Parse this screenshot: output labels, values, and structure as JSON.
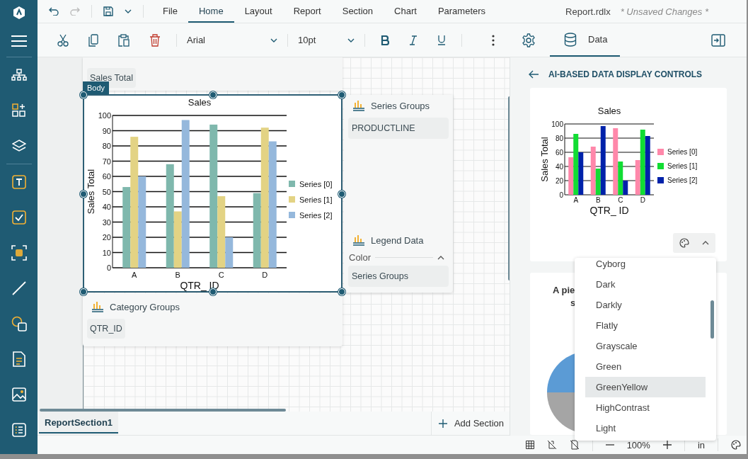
{
  "app": {
    "file_name": "Report.rdlx",
    "status": "* Unsaved Changes *"
  },
  "menu_tabs": [
    {
      "label": "File",
      "selected": false
    },
    {
      "label": "Home",
      "selected": true
    },
    {
      "label": "Layout",
      "selected": false
    },
    {
      "label": "Report",
      "selected": false
    },
    {
      "label": "Section",
      "selected": false
    },
    {
      "label": "Chart",
      "selected": false
    },
    {
      "label": "Parameters",
      "selected": false
    }
  ],
  "toolbar": {
    "font": "Arial",
    "font_size": "10pt",
    "data_tab": {
      "label": "Data",
      "selected": true
    }
  },
  "canvas": {
    "top_field": "Sales Total",
    "body_label": "Body",
    "chart_data": {
      "type": "bar",
      "title": "Sales",
      "xlabel": "QTR_ ID",
      "ylabel": "Sales Total",
      "categories": [
        "A",
        "B",
        "C",
        "D"
      ],
      "series": [
        {
          "name": "Series [0]",
          "color": "#7fb8ad",
          "values": [
            53,
            68,
            94,
            49
          ]
        },
        {
          "name": "Series [1]",
          "color": "#e3d384",
          "values": [
            86,
            37,
            47,
            92
          ]
        },
        {
          "name": "Series [2]",
          "color": "#95b8dc",
          "values": [
            60,
            97,
            20,
            83
          ]
        }
      ],
      "ylim": [
        0,
        100
      ],
      "yticks": [
        0,
        10,
        20,
        30,
        40,
        50,
        60,
        70,
        80,
        90,
        100
      ],
      "grid": true,
      "legend": true
    },
    "series_groups": {
      "title": "Series Groups",
      "items": [
        "PRODUCTLINE"
      ]
    },
    "legend_data": {
      "title": "Legend Data",
      "color_label": "Color",
      "expanded": true,
      "items": [
        "Series Groups"
      ]
    },
    "category_groups": {
      "title": "Category Groups",
      "items": [
        "QTR_ID"
      ]
    }
  },
  "sections": [
    {
      "label": "ReportSection1",
      "selected": true
    }
  ],
  "add_section": "Add Section",
  "panel": {
    "title": "AI-BASED DATA DISPLAY CONTROLS",
    "chart_card": {
      "chart_data": {
        "type": "bar",
        "title": "Sales",
        "xlabel": "QTR_ ID",
        "ylabel": "Sales Total",
        "categories": [
          "A",
          "B",
          "C",
          "D"
        ],
        "series": [
          {
            "name": "Series [0]",
            "color": "#ff88aa",
            "values": [
              53,
              68,
              94,
              49
            ]
          },
          {
            "name": "Series [1]",
            "color": "#11dd33",
            "values": [
              86,
              37,
              47,
              92
            ]
          },
          {
            "name": "Series [2]",
            "color": "#0022aa",
            "values": [
              60,
              97,
              20,
              83
            ]
          }
        ],
        "ylim": [
          0,
          100
        ],
        "yticks": [
          0,
          20,
          40,
          60,
          80,
          100
        ],
        "grid": true,
        "legend": true
      }
    },
    "pie_card": {
      "title_lines": [
        "A pie",
        "s"
      ]
    },
    "theme_menu": {
      "expanded": true,
      "items": [
        {
          "label": "Cyborg",
          "selected": false
        },
        {
          "label": "Dark",
          "selected": false
        },
        {
          "label": "Darkly",
          "selected": false
        },
        {
          "label": "Flatly",
          "selected": false
        },
        {
          "label": "Grayscale",
          "selected": false
        },
        {
          "label": "Green",
          "selected": false
        },
        {
          "label": "GreenYellow",
          "selected": true
        },
        {
          "label": "HighContrast",
          "selected": false
        },
        {
          "label": "Light",
          "selected": false
        }
      ]
    }
  },
  "status_bar": {
    "zoom": "100%",
    "unit": "in"
  }
}
